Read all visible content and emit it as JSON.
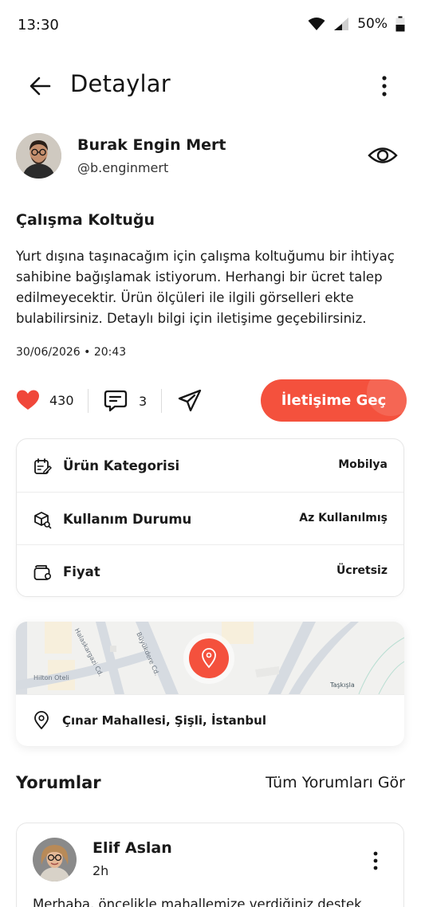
{
  "status_bar": {
    "time": "13:30",
    "battery": "50%"
  },
  "app_bar": {
    "title": "Detaylar"
  },
  "profile": {
    "name": "Burak Engin Mert",
    "handle": "@b.enginmert"
  },
  "post": {
    "title": "Çalışma Koltuğu",
    "body": "Yurt dışına taşınacağım için çalışma koltuğumu bir ihtiyaç sahibine bağışlamak istiyorum. Herhangi bir ücret talep edilmeyecektir. Ürün ölçüleri ile ilgili görselleri ekte bulabilirsiniz. Detaylı bilgi için iletişime geçebilirsiniz.",
    "date": "30/06/2026 • 20:43"
  },
  "actions": {
    "likes": "430",
    "comments": "3",
    "contact_label": "İletişime Geç"
  },
  "details": [
    {
      "label": "Ürün Kategorisi",
      "value": "Mobilya",
      "icon": "calendar-edit-icon"
    },
    {
      "label": "Kullanım Durumu",
      "value": "Az Kullanılmış",
      "icon": "box-search-icon"
    },
    {
      "label": "Fiyat",
      "value": "Ücretsiz",
      "icon": "wallet-icon"
    }
  ],
  "map": {
    "location": "Çınar Mahallesi, Şişli, İstanbul",
    "labels": {
      "street_1": "Hilton Oteli",
      "street_2": "Halaskargazi Cd.",
      "street_3": "Büyükdere Cd.",
      "station": "Taşkışla"
    }
  },
  "comments": {
    "title": "Yorumlar",
    "see_all": "Tüm Yorumları Gör",
    "items": [
      {
        "name": "Elif Aslan",
        "time": "2h",
        "text": "Merhaba, öncelikle mahallemize verdiğiniz destek"
      }
    ]
  },
  "colors": {
    "accent": "#f4513d",
    "text": "#1a1a1a",
    "border": "#e6e6e6"
  }
}
